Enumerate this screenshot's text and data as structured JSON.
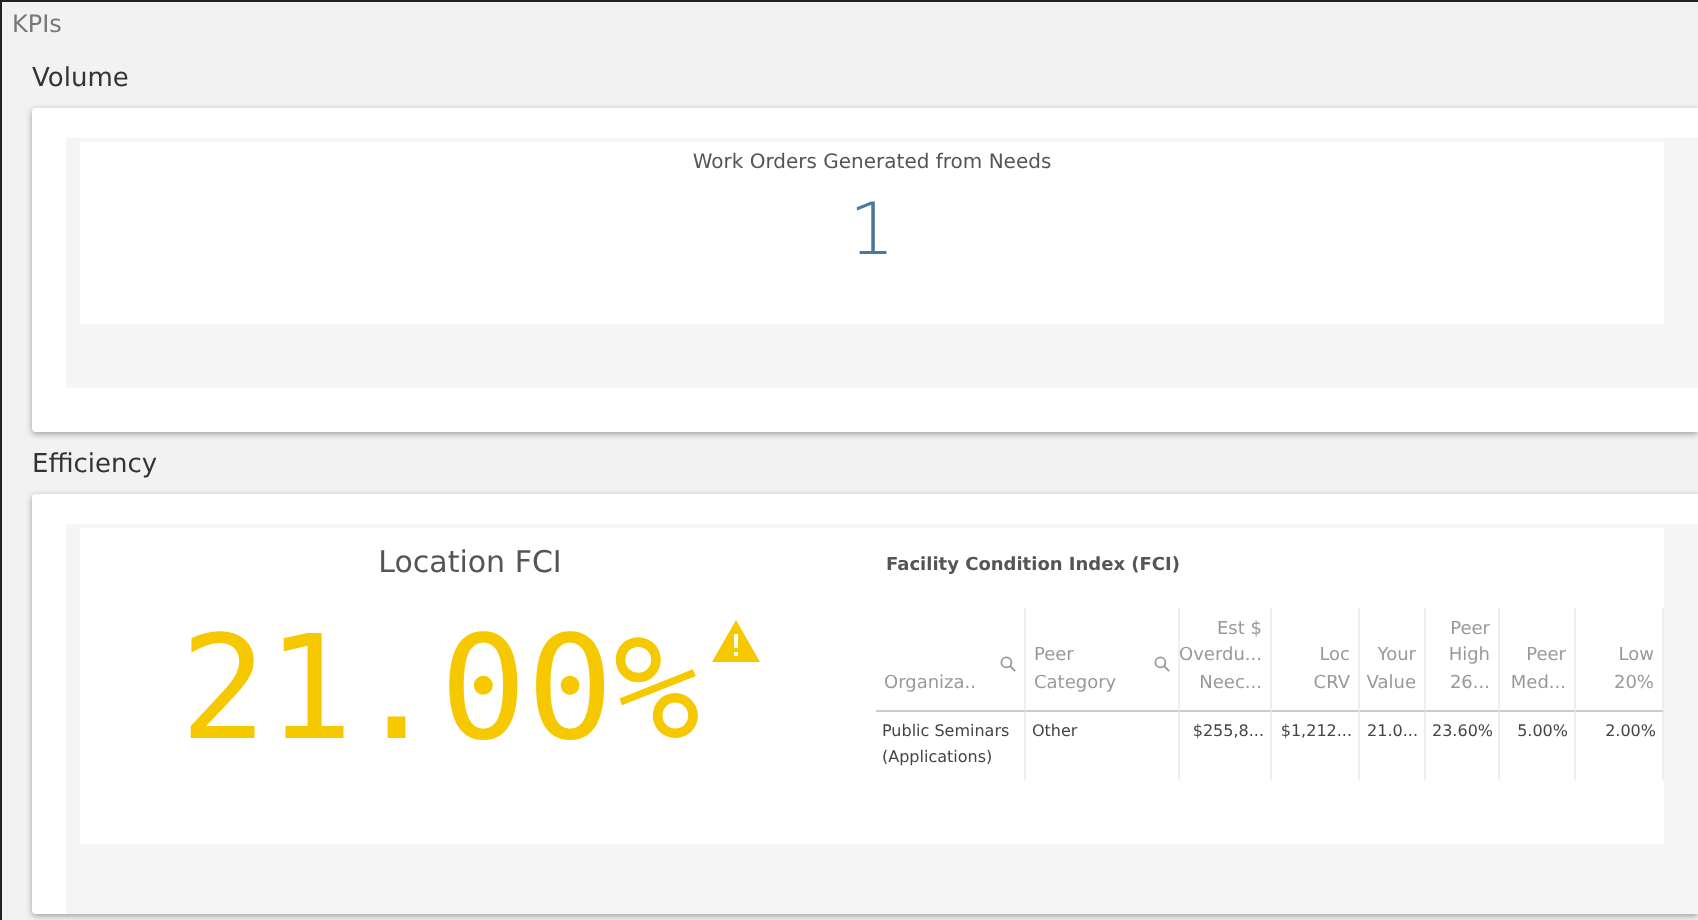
{
  "page_title": "KPIs",
  "sections": [
    {
      "title": "Volume",
      "kpi": {
        "title": "Work Orders Generated from Needs",
        "value": "1"
      }
    },
    {
      "title": "Efficiency",
      "kpi": {
        "title": "Location FCI",
        "value": "21.00%",
        "warning": true
      },
      "table": {
        "title": "Facility Condition Index (FCI)",
        "columns": [
          {
            "label": "Organiza..",
            "kind": "dimension"
          },
          {
            "label": "Peer\nCategory",
            "kind": "dimension"
          },
          {
            "label": "Est $\nOverdu...\nNeec...",
            "kind": "measure"
          },
          {
            "label": "Loc\nCRV",
            "kind": "measure"
          },
          {
            "label": "Your\nValue",
            "kind": "measure"
          },
          {
            "label": "Peer\nHigh\n26...",
            "kind": "measure"
          },
          {
            "label": "Peer\nMed...",
            "kind": "measure"
          },
          {
            "label": "Low\n20%",
            "kind": "measure"
          }
        ],
        "rows": [
          [
            "Public Seminars (Applications)",
            "Other",
            "$255,8...",
            "$1,212...",
            "21.0...",
            "23.60%",
            "5.00%",
            "2.00%"
          ]
        ]
      }
    }
  ]
}
